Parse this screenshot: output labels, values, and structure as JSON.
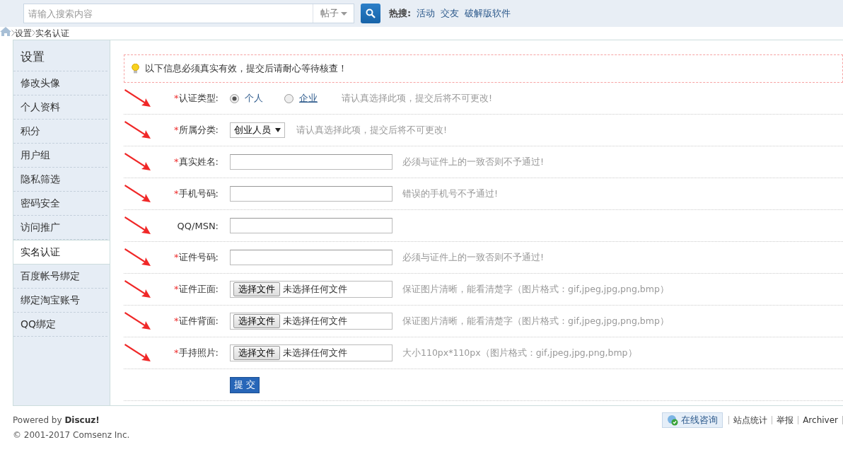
{
  "search": {
    "placeholder": "请输入搜索内容",
    "scope": "帖子",
    "hot_label": "热搜:",
    "hot_links": [
      "活动",
      "交友",
      "破解版软件"
    ]
  },
  "breadcrumb": [
    "设置",
    "实名认证"
  ],
  "sidebar": {
    "title": "设置",
    "items": [
      {
        "label": "修改头像",
        "selected": false
      },
      {
        "label": "个人资料",
        "selected": false
      },
      {
        "label": "积分",
        "selected": false
      },
      {
        "label": "用户组",
        "selected": false
      },
      {
        "label": "隐私筛选",
        "selected": false
      },
      {
        "label": "密码安全",
        "selected": false
      },
      {
        "label": "访问推广",
        "selected": false
      },
      {
        "label": "实名认证",
        "selected": true
      },
      {
        "label": "百度帐号绑定",
        "selected": false
      },
      {
        "label": "绑定淘宝账号",
        "selected": false
      },
      {
        "label": "QQ绑定",
        "selected": false
      }
    ]
  },
  "notice": "以下信息必须真实有效，提交后请耐心等待核查！",
  "rows": [
    {
      "kind": "radio",
      "label": "认证类型:",
      "required": true,
      "arrow": true,
      "options": [
        {
          "label": "个人",
          "selected": true
        },
        {
          "label": "企业",
          "selected": false
        }
      ],
      "hint": "请认真选择此项，提交后将不可更改!"
    },
    {
      "kind": "select",
      "label": "所属分类:",
      "required": true,
      "arrow": true,
      "value": "创业人员",
      "hint": "请认真选择此项，提交后将不可更改!"
    },
    {
      "kind": "text",
      "label": "真实姓名:",
      "required": true,
      "arrow": true,
      "hint": "必须与证件上的一致否则不予通过!"
    },
    {
      "kind": "text",
      "label": "手机号码:",
      "required": true,
      "arrow": true,
      "hint": "错误的手机号不予通过!"
    },
    {
      "kind": "text",
      "label": "QQ/MSN:",
      "required": false,
      "arrow": true
    },
    {
      "kind": "text",
      "label": "证件号码:",
      "required": true,
      "arrow": true,
      "hint": "必须与证件上的一致否则不予通过!"
    },
    {
      "kind": "file",
      "label": "证件正面:",
      "required": true,
      "arrow": true,
      "button": "选择文件",
      "status": "未选择任何文件",
      "hint": "保证图片清晰，能看清楚字（图片格式：gif,jpeg,jpg,png,bmp）"
    },
    {
      "kind": "file",
      "label": "证件背面:",
      "required": true,
      "arrow": true,
      "button": "选择文件",
      "status": "未选择任何文件",
      "hint": "保证图片清晰，能看清楚字（图片格式：gif,jpeg,jpg,png,bmp）"
    },
    {
      "kind": "file",
      "label": "手持照片:",
      "required": true,
      "arrow": true,
      "button": "选择文件",
      "status": "未选择任何文件",
      "hint": "大小110px*110px（图片格式：gif,jpeg,jpg,png,bmp）"
    },
    {
      "kind": "submit",
      "button": "提 交"
    }
  ],
  "required_mark": "*",
  "footer": {
    "powered": "Powered by **Discuz!**",
    "copyright": "© 2001-2017 Comsenz Inc.",
    "consult": "在线咨询",
    "links": [
      "站点统计",
      "举报",
      "Archiver"
    ]
  }
}
